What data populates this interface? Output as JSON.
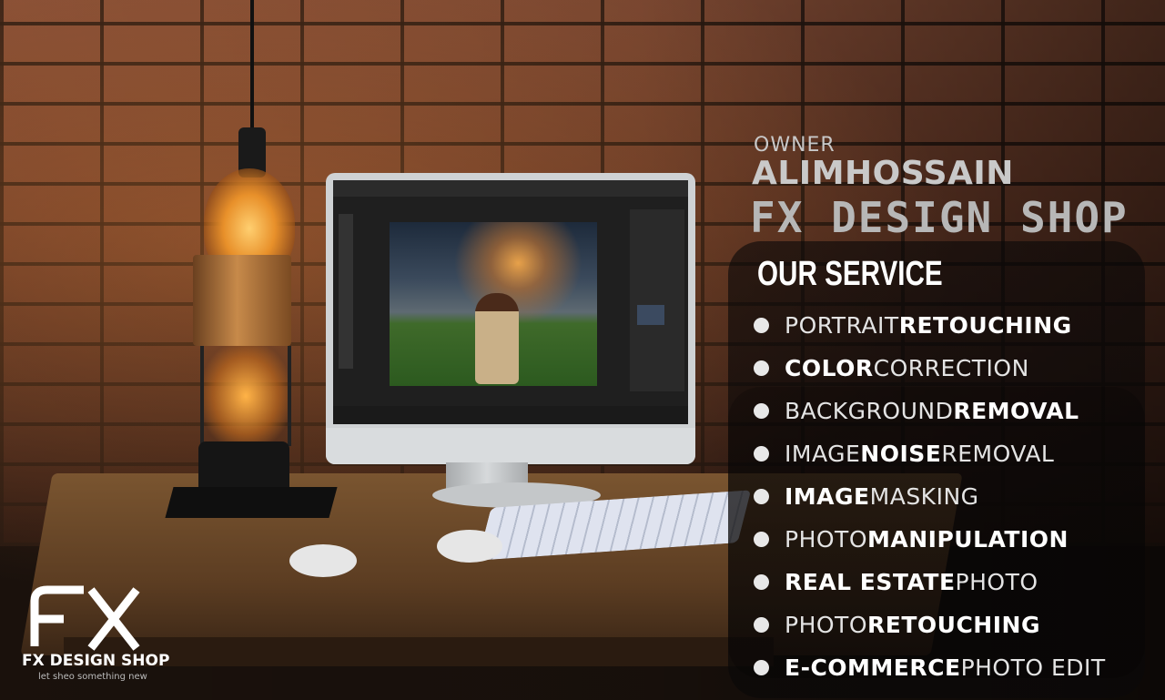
{
  "header": {
    "owner_label": "OWNER",
    "owner_name": "ALIMHOSSAIN",
    "brand": "FX DESIGN SHOP"
  },
  "services": {
    "title": "OUR SERVICE",
    "items": [
      {
        "a": "PORTRAIT ",
        "b": "RETOUCHING",
        "first_bold": false
      },
      {
        "a": "COLOR ",
        "b": "CORRECTION",
        "first_bold": true
      },
      {
        "a": "BACKGROUND ",
        "b": "REMOVAL",
        "first_bold": false
      },
      {
        "a": "IMAGE ",
        "b": "NOISE",
        "c": " REMOVAL",
        "first_bold": false
      },
      {
        "a": "IMAGE ",
        "b": "MASKING",
        "first_bold": true
      },
      {
        "a": "PHOTO ",
        "b": "MANIPULATION",
        "first_bold": false
      },
      {
        "a": "REAL ESTATE ",
        "b": "PHOTO",
        "first_bold": true
      },
      {
        "a": "PHOTO ",
        "b": "RETOUCHING",
        "first_bold": false
      },
      {
        "a": "E-COMMERCE ",
        "b": "PHOTO EDIT",
        "first_bold": true
      }
    ]
  },
  "logo": {
    "mark": "FX",
    "name": "FX DESIGN SHOP",
    "tagline": "let sheo something new"
  },
  "colors": {
    "overlay": "#0a0808",
    "text": "#ffffff",
    "brand_grey": "#b7b7b7"
  }
}
